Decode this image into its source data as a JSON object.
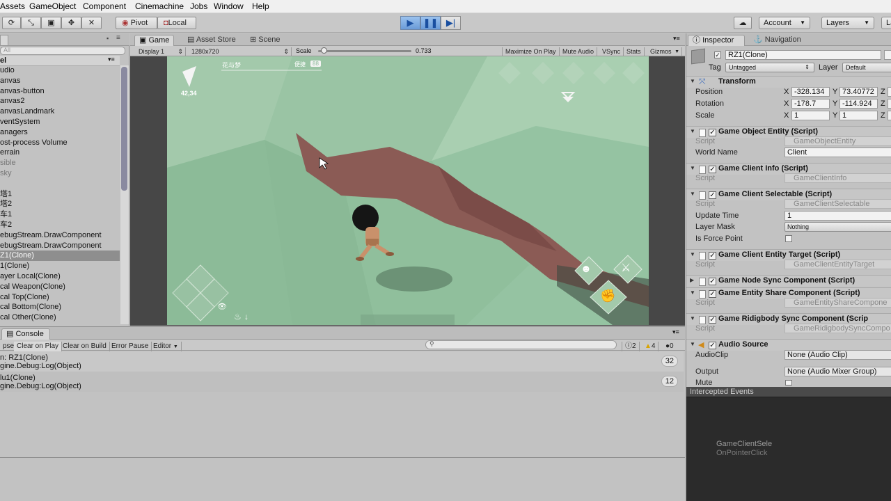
{
  "menu": [
    "Assets",
    "GameObject",
    "Component",
    "Cinemachine",
    "Jobs",
    "Window",
    "Help"
  ],
  "toolbar": {
    "pivot_label": "Pivot",
    "local_label": "Local",
    "account_label": "Account",
    "layers_label": "Layers",
    "layout_label": "La"
  },
  "hierarchy": {
    "search_placeholder": "All",
    "header": "el",
    "items": [
      {
        "label": "udio",
        "state": "normal"
      },
      {
        "label": "anvas",
        "state": "normal"
      },
      {
        "label": "anvas-button",
        "state": "normal"
      },
      {
        "label": "anvas2",
        "state": "normal"
      },
      {
        "label": "anvasLandmark",
        "state": "normal"
      },
      {
        "label": "ventSystem",
        "state": "normal"
      },
      {
        "label": "anagers",
        "state": "normal"
      },
      {
        "label": "ost-process Volume",
        "state": "normal"
      },
      {
        "label": "errain",
        "state": "normal"
      },
      {
        "label": "sible",
        "state": "dim"
      },
      {
        "label": "sky",
        "state": "dim"
      },
      {
        "label": "",
        "state": "normal"
      },
      {
        "label": "塔1",
        "state": "normal"
      },
      {
        "label": "塔2",
        "state": "normal"
      },
      {
        "label": "车1",
        "state": "normal"
      },
      {
        "label": "车2",
        "state": "normal"
      },
      {
        "label": "ebugStream.DrawComponent",
        "state": "normal"
      },
      {
        "label": "ebugStream.DrawComponent",
        "state": "normal"
      },
      {
        "label": "Z1(Clone)",
        "state": "selected"
      },
      {
        "label": "1(Clone)",
        "state": "normal"
      },
      {
        "label": "ayer Local(Clone)",
        "state": "normal"
      },
      {
        "label": "cal Weapon(Clone)",
        "state": "normal"
      },
      {
        "label": "cal Top(Clone)",
        "state": "normal"
      },
      {
        "label": "cal Bottom(Clone)",
        "state": "normal"
      },
      {
        "label": "cal Other(Clone)",
        "state": "normal"
      }
    ]
  },
  "game": {
    "tabs": [
      "Game",
      "Asset Store",
      "Scene"
    ],
    "display": "Display 1",
    "resolution": "1280x720",
    "scale_label": "Scale",
    "scale_value": "0.733",
    "scale_fraction": 0.06,
    "tools": [
      "Maximize On Play",
      "Mute Audio",
      "VSync",
      "Stats",
      "Gizmos"
    ],
    "hud_player_name": "花与梦",
    "hud_coords": "42,34",
    "hud_right_label": "便捷",
    "hud_right_value": "88"
  },
  "console": {
    "tab": "Console",
    "buttons": [
      "pse",
      "Clear on Play",
      "Clear on Build",
      "Error Pause",
      "Editor"
    ],
    "counts": {
      "warnings_info": "2",
      "warnings": "4",
      "errors": "0"
    },
    "logs": [
      {
        "line1": "n: RZ1(Clone)",
        "line2": "gine.Debug:Log(Object)",
        "count": "32"
      },
      {
        "line1": "lu1(Clone)",
        "line2": "gine.Debug:Log(Object)",
        "count": "12"
      }
    ]
  },
  "inspector": {
    "tabs": [
      "Inspector",
      "Navigation"
    ],
    "object_name": "RZ1(Clone)",
    "tag_label": "Tag",
    "tag_value": "Untagged",
    "layer_label": "Layer",
    "layer_value": "Default",
    "transform": {
      "title": "Transform",
      "position_label": "Position",
      "rotation_label": "Rotation",
      "scale_label": "Scale",
      "px": "-328.134",
      "py": "73.40772",
      "rx": "-178.7",
      "ry": "-114.924",
      "sx": "1",
      "sy": "1"
    },
    "components": [
      {
        "title": "Game Object Entity (Script)",
        "script": "GameObjectEntity"
      },
      {
        "title": "Game Client Info (Script)",
        "script": "GameClientInfo"
      },
      {
        "title": "Game Client Selectable (Script)",
        "script": "GameClientSelectable"
      },
      {
        "title": "Game Client Entity Target (Script)",
        "script": "GameClientEntityTarget"
      },
      {
        "title": "Game Node Sync Component (Script)",
        "script": ""
      },
      {
        "title": "Game Entity Share Component (Script)",
        "script": "GameEntityShareCompone"
      },
      {
        "title": "Game Ridigbody Sync Component (Scrip",
        "script": "GameRidigbodySyncCompo"
      },
      {
        "title": "Audio Source",
        "script": ""
      }
    ],
    "script_label": "Script",
    "world_name_label": "World Name",
    "world_name_value": "Client",
    "update_time_label": "Update Time",
    "update_time_value": "1",
    "layer_mask_label": "Layer Mask",
    "layer_mask_value": "Nothing",
    "is_force_point_label": "Is Force Point",
    "audio_clip_label": "AudioClip",
    "audio_clip_value": "None (Audio Clip)",
    "output_label": "Output",
    "output_value": "None (Audio Mixer Group)",
    "mute_label": "Mute"
  },
  "events": {
    "title": "Intercepted Events",
    "line1": "GameClientSele",
    "line2": "OnPointerClick"
  },
  "colors": {
    "play_blue": "#6a9bd8",
    "selected_row": "#8e8e8e",
    "game_green": "#8fbb9c",
    "rock_brown": "#8b5b55",
    "events_bg": "#2b2b2b"
  }
}
